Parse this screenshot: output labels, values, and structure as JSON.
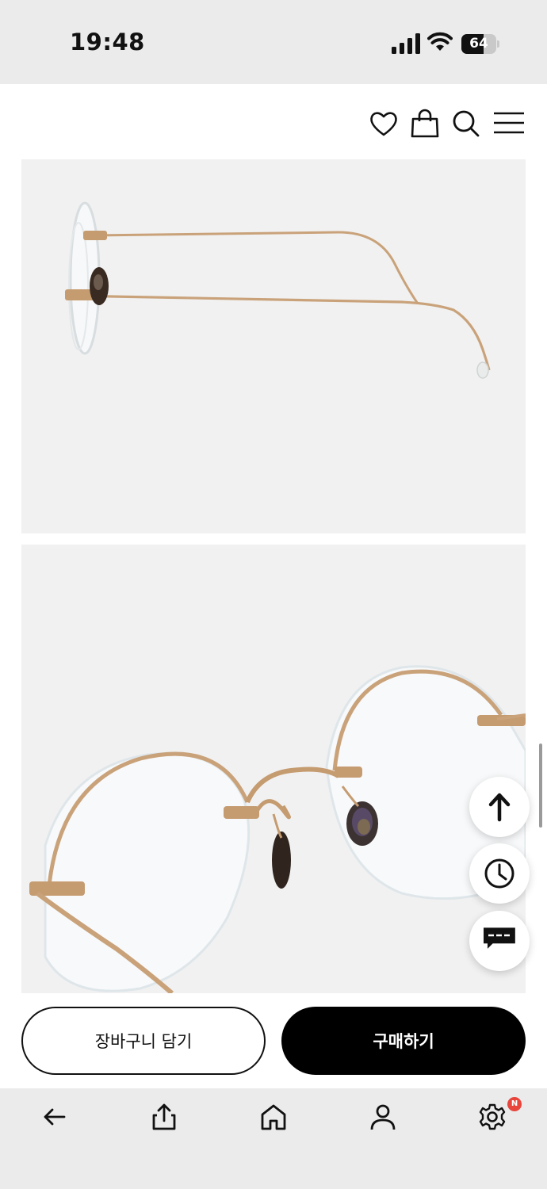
{
  "status_bar": {
    "time": "19:48",
    "battery_level": "64",
    "battery_fraction": 0.64,
    "icons": [
      "cellular-signal-icon",
      "wifi-icon",
      "battery-icon"
    ]
  },
  "header": {
    "icons": [
      "heart-icon",
      "shopping-bag-icon",
      "search-icon",
      "hamburger-menu-icon"
    ]
  },
  "product_images": [
    {
      "view": "side",
      "description_hint": "glasses-side-view"
    },
    {
      "view": "front-angle",
      "description_hint": "glasses-front-angle-view"
    }
  ],
  "floating_buttons": [
    "arrow-up-icon",
    "clock-icon",
    "chat-icon"
  ],
  "purchase_bar": {
    "cart_label": "장바구니 담기",
    "buy_label": "구매하기"
  },
  "bottom_nav": {
    "icons": [
      "back-arrow-icon",
      "share-icon",
      "home-icon",
      "user-icon",
      "gear-icon"
    ],
    "settings_badge": "N"
  },
  "colors": {
    "status_bg": "#ebebeb",
    "photo_bg": "#f1f1f1",
    "buy_button": "#000000",
    "badge": "#e8453c",
    "frame_gold": "#c9a27a"
  }
}
